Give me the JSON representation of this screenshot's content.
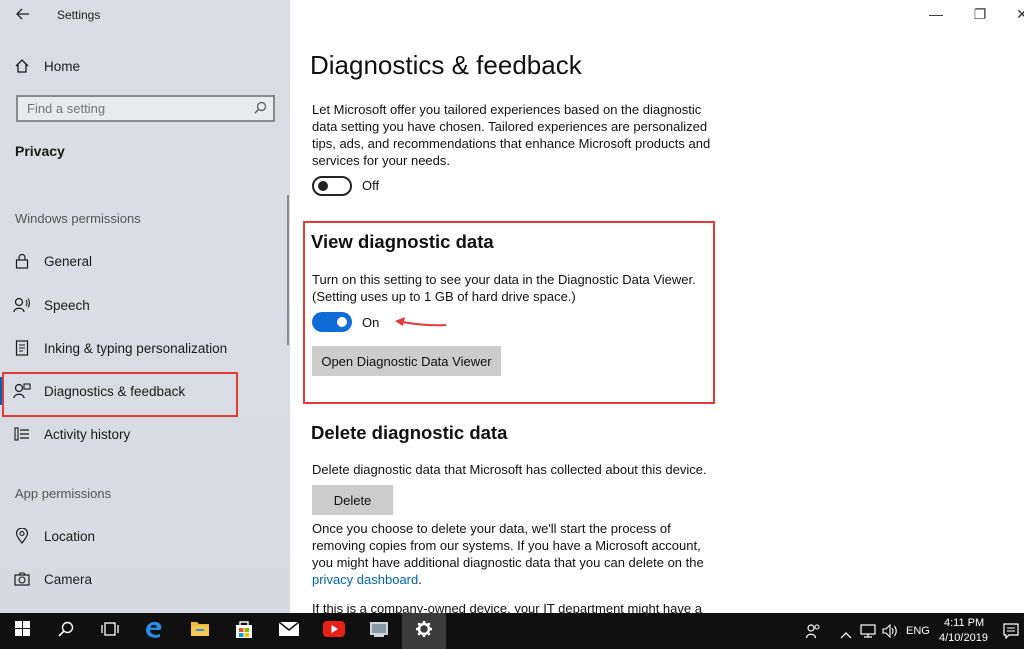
{
  "window": {
    "app_title": "Settings",
    "back_icon": "back-arrow-icon",
    "minimize_glyph": "—",
    "maximize_glyph": "❐",
    "close_glyph": "✕"
  },
  "sidebar": {
    "home_label": "Home",
    "search_placeholder": "Find a setting",
    "section_title": "Privacy",
    "windows_permissions_header": "Windows permissions",
    "windows_items": [
      {
        "label": "General",
        "icon": "lock-icon"
      },
      {
        "label": "Speech",
        "icon": "speech-icon"
      },
      {
        "label": "Inking & typing personalization",
        "icon": "inking-icon"
      },
      {
        "label": "Diagnostics & feedback",
        "icon": "diagnostics-icon",
        "selected": true
      },
      {
        "label": "Activity history",
        "icon": "activity-icon"
      }
    ],
    "app_permissions_header": "App permissions",
    "app_items": [
      {
        "label": "Location",
        "icon": "location-icon"
      },
      {
        "label": "Camera",
        "icon": "camera-icon"
      }
    ]
  },
  "main": {
    "page_title": "Diagnostics & feedback",
    "tailored_text": "Let Microsoft offer you tailored experiences based on the diagnostic data setting you have chosen. Tailored experiences are personalized tips, ads, and recommendations that enhance Microsoft products and services for your needs.",
    "tailored_toggle_label": "Off",
    "tailored_toggle_on": false,
    "view_heading": "View diagnostic data",
    "view_text": "Turn on this setting to see your data in the Diagnostic Data Viewer. (Setting uses up to 1 GB of hard drive space.)",
    "view_toggle_label": "On",
    "view_toggle_on": true,
    "open_viewer_button": "Open Diagnostic Data Viewer",
    "delete_heading": "Delete diagnostic data",
    "delete_text": "Delete diagnostic data that Microsoft has collected about this device.",
    "delete_button": "Delete",
    "delete_info_text": "Once you choose to delete your data, we'll start the process of removing copies from our systems. If you have a Microsoft account, you might have additional diagnostic data that you can delete on the",
    "privacy_link_text": "privacy dashboard",
    "delete_info_end": ".",
    "cutoff_text": "If this is a company-owned device, your IT department might have a"
  },
  "annotations": {
    "highlight_color": "#e23a3a"
  },
  "taskbar": {
    "items": [
      "start-icon",
      "search-icon",
      "task-view-icon",
      "edge-icon",
      "file-explorer-icon",
      "store-icon",
      "mail-icon",
      "youtube-icon",
      "app-icon",
      "settings-icon"
    ],
    "language": "ENG",
    "time": "4:11 PM",
    "date": "4/10/2019"
  }
}
